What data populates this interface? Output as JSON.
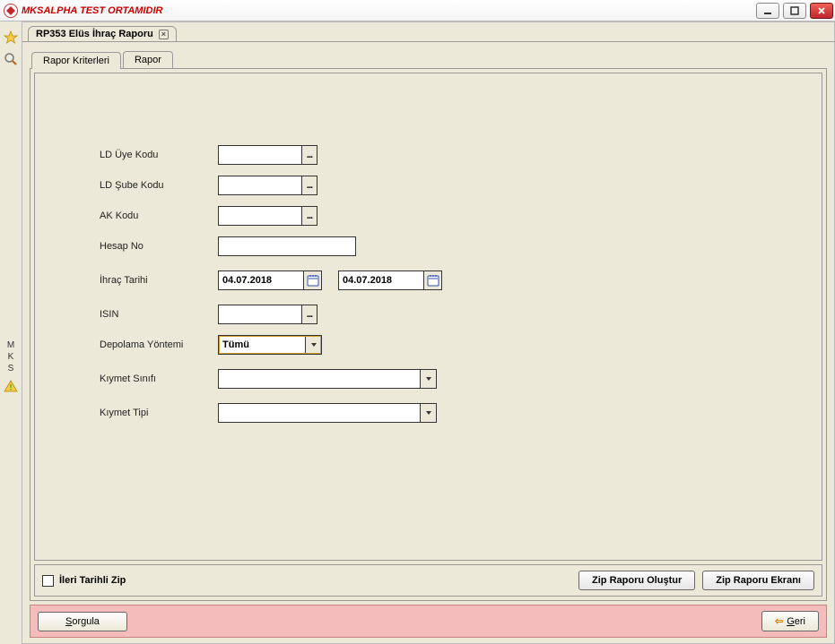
{
  "window": {
    "title": "MKSALPHA TEST ORTAMIDIR"
  },
  "docTab": {
    "label": "RP353 Elüs İhraç Raporu"
  },
  "sideRail": {
    "letters": [
      "M",
      "K",
      "S"
    ]
  },
  "innerTabs": {
    "kriterleri": "Rapor Kriterleri",
    "rapor": "Rapor"
  },
  "labels": {
    "ldUyeKodu": "LD Üye Kodu",
    "ldSubeKodu": "LD Şube Kodu",
    "akKodu": "AK Kodu",
    "hesapNo": "Hesap No",
    "ihracTarihi": "İhraç Tarihi",
    "isin": "ISIN",
    "depolama": "Depolama Yöntemi",
    "kiymetSinifi": "Kıymet Sınıfı",
    "kiymetTipi": "Kıymet Tipi"
  },
  "values": {
    "ldUyeKodu": "",
    "ldSubeKodu": "",
    "akKodu": "",
    "hesapNo": "",
    "ihracTarihiFrom": "04.07.2018",
    "ihracTarihiTo": "04.07.2018",
    "isin": "",
    "depolama": "Tümü",
    "kiymetSinifi": "",
    "kiymetTipi": ""
  },
  "zipBar": {
    "checkboxLabel": "İleri Tarihli Zip",
    "btnOlustur": "Zip Raporu Oluştur",
    "btnEkrani": "Zip Raporu Ekranı"
  },
  "actionBar": {
    "sorgula": "Sorgula",
    "sorgulaKey": "S",
    "geri": "Geri",
    "geriKey": "G"
  }
}
